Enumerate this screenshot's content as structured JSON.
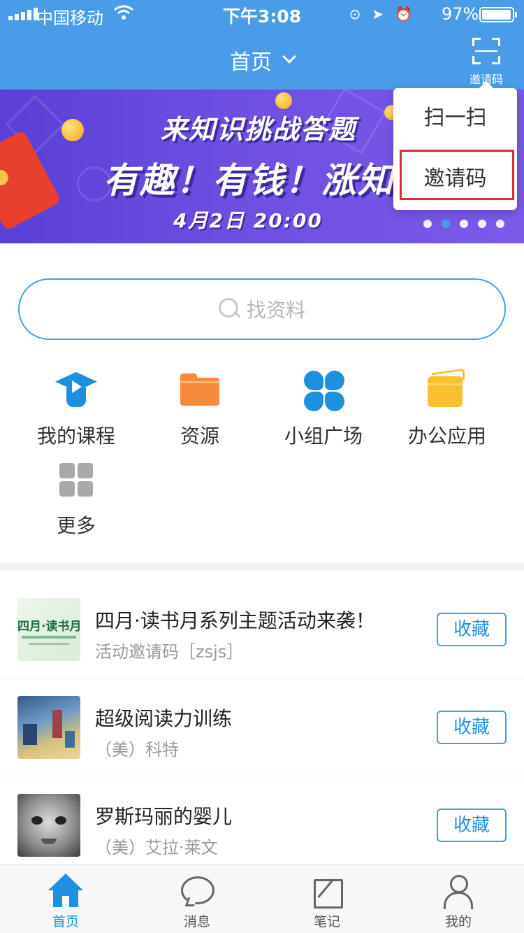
{
  "status_bar": {
    "carrier": "中国移动",
    "time": "下午3:08",
    "battery": "97%",
    "battery_level": 0.97
  },
  "header": {
    "title": "首页",
    "scan_label": "邀请码"
  },
  "banner": {
    "headline": "来知识挑战答题",
    "tagline": "有趣！有钱！涨知识",
    "date": "4月2日  20:00",
    "page_count": 5,
    "active_page": 1
  },
  "popover_menu": {
    "items": [
      "扫一扫",
      "邀请码"
    ],
    "highlighted": "邀请码"
  },
  "search": {
    "placeholder": "找资料"
  },
  "shortcuts": [
    {
      "label": "我的课程",
      "icon": "graduation-cap-icon"
    },
    {
      "label": "资源",
      "icon": "folder-icon"
    },
    {
      "label": "小组广场",
      "icon": "group-icon"
    },
    {
      "label": "办公应用",
      "icon": "wallet-icon"
    },
    {
      "label": "更多",
      "icon": "grid-icon"
    }
  ],
  "feed": [
    {
      "title": "四月·读书月系列主题活动来袭！",
      "subtitle": "活动邀请码［zsjs］",
      "action": "收藏",
      "thumb_text": "四月·读书月"
    },
    {
      "title": "超级阅读力训练",
      "subtitle": "（美）科特",
      "action": "收藏"
    },
    {
      "title": "罗斯玛丽的婴儿",
      "subtitle": "（美）艾拉·莱文",
      "action": "收藏"
    }
  ],
  "tabbar": [
    {
      "label": "首页",
      "icon": "home-icon",
      "active": true
    },
    {
      "label": "消息",
      "icon": "message-icon",
      "active": false
    },
    {
      "label": "笔记",
      "icon": "note-icon",
      "active": false
    },
    {
      "label": "我的",
      "icon": "user-icon",
      "active": false
    }
  ],
  "colors": {
    "primary": "#4a9ce8",
    "accent": "#1f8fe0",
    "highlight_border": "#e0293b"
  }
}
